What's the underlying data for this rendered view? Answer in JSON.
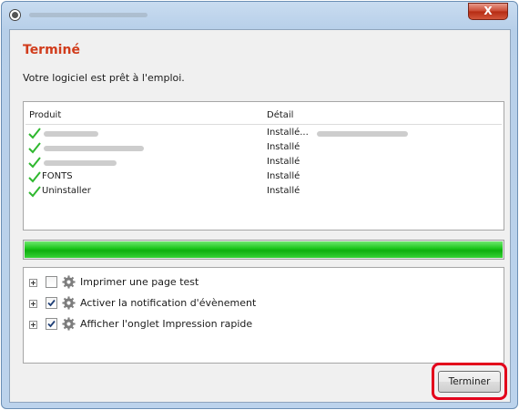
{
  "window": {
    "close_label": "X"
  },
  "header": {
    "title": "Terminé",
    "subtitle": "Votre logiciel est prêt à l'emploi."
  },
  "table": {
    "columns": [
      "Produit",
      "Détail"
    ],
    "rows": [
      {
        "name": "",
        "detail": "Installé..."
      },
      {
        "name": "",
        "detail": "Installé"
      },
      {
        "name": "",
        "detail": "Installé"
      },
      {
        "name": "FONTS",
        "detail": "Installé"
      },
      {
        "name": "Uninstaller",
        "detail": "Installé"
      }
    ]
  },
  "progress": {
    "value": 1.0,
    "color": "#18c418"
  },
  "options": [
    {
      "label": "Imprimer une page test",
      "checked": false
    },
    {
      "label": "Activer la notification d'évènement",
      "checked": true
    },
    {
      "label": "Afficher l'onglet Impression rapide",
      "checked": true
    }
  ],
  "footer": {
    "finish_label": "Terminer"
  },
  "colors": {
    "heading": "#d13c1c",
    "check": "#2fb82f",
    "highlight": "#e3001b"
  },
  "icons": {
    "app": "app-icon",
    "check": "check-icon",
    "settings": "gear-icon",
    "expand": "expand-icon"
  }
}
